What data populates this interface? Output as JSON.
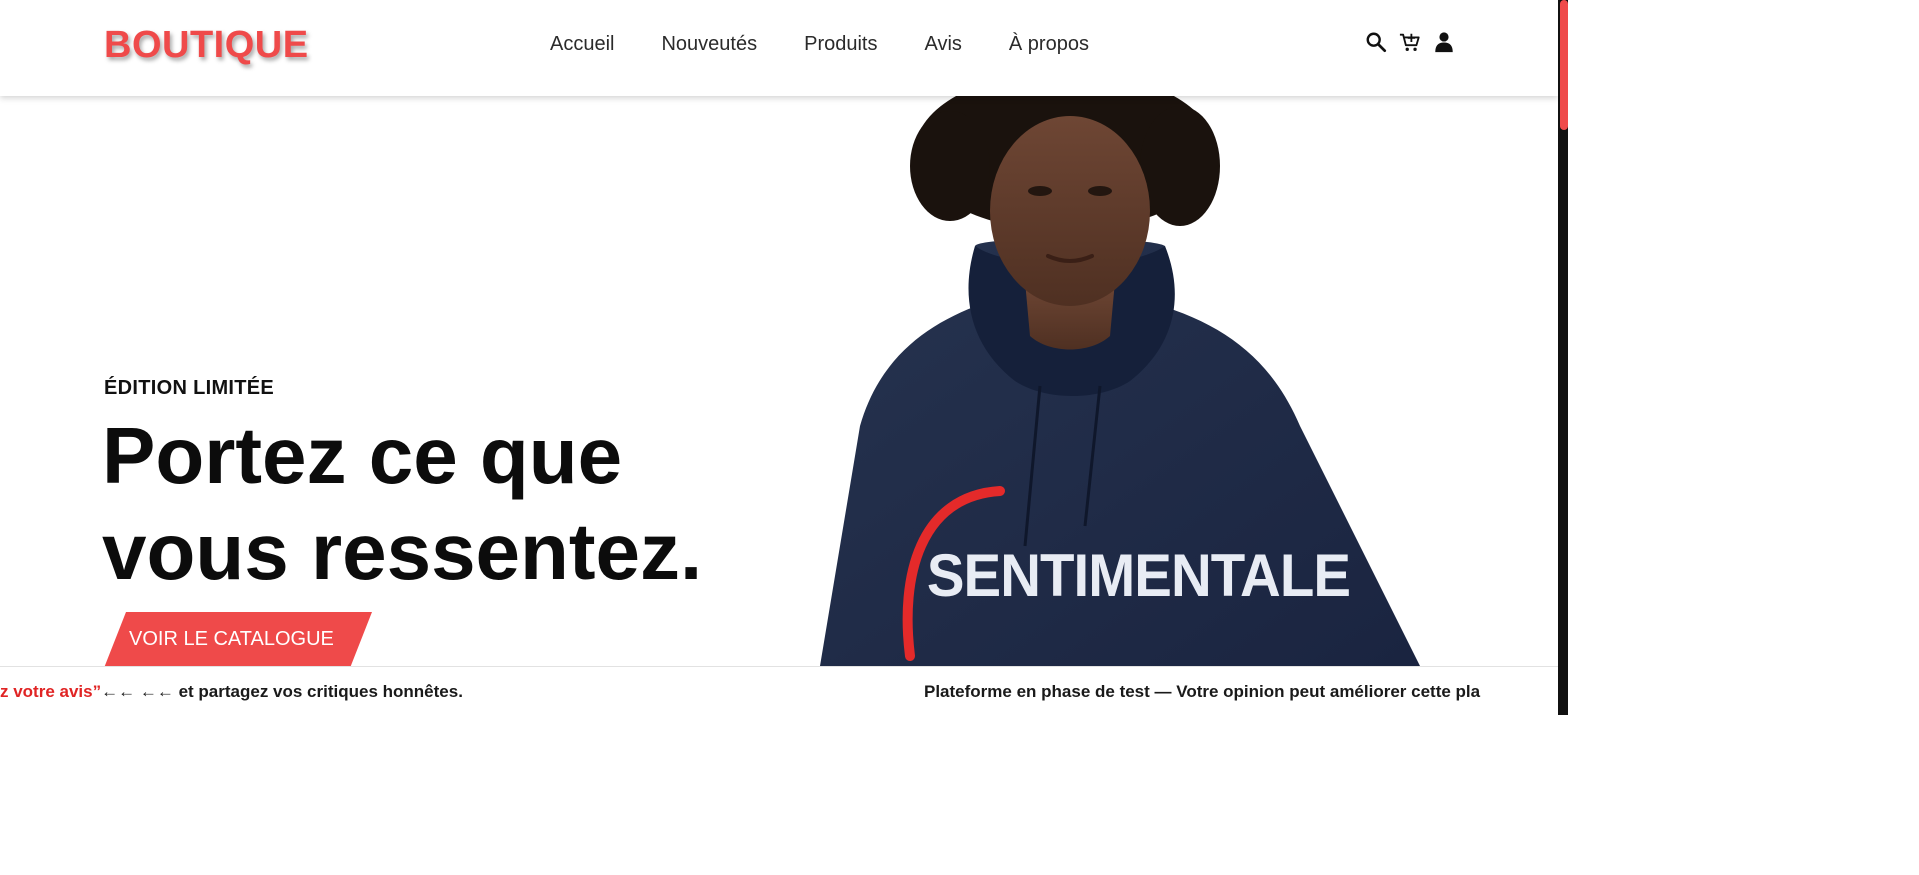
{
  "header": {
    "logo": "BOUTIQUE",
    "nav": [
      "Accueil",
      "Nouveutés",
      "Produits",
      "Avis",
      "À propos"
    ],
    "icons": [
      "search-icon",
      "cart-icon",
      "user-icon"
    ]
  },
  "hero": {
    "kicker": "ÉDITION LIMITÉE",
    "title_line1": "Portez ce que",
    "title_line2": "vous ressentez.",
    "cta": "VOIR LE CATALOGUE",
    "image": {
      "subject": "model wearing navy hoodie",
      "hoodie_print": "SENTIMENTALE"
    }
  },
  "marquee": {
    "segment1_red": "z votre avis”",
    "segment1_arrows": "←←  ←←",
    "segment1_rest": " et partagez vos critiques honnêtes.",
    "segment2": "Plateforme en phase de test — Votre opinion peut améliorer cette pla"
  },
  "colors": {
    "accent": "#ef4a4a",
    "text": "#111111",
    "hoodie": "#1f2a44",
    "scrollbar": "#111111"
  }
}
